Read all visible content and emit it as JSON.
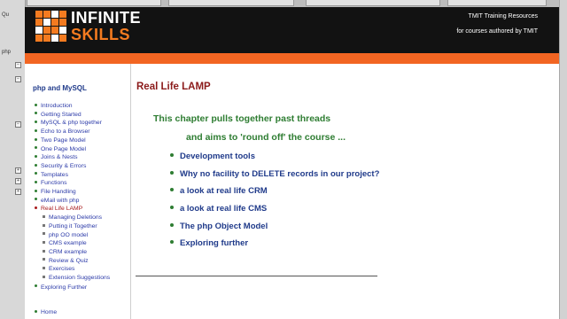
{
  "window": {
    "gutter_labels": [
      "Qu",
      "php"
    ]
  },
  "header": {
    "logo_line1": "INFINITE",
    "logo_line2": "SKILLS",
    "right_line1": "TMIT Training Resources",
    "right_line2": "for courses authored by TMIT"
  },
  "nav": {
    "title": "php and MySQL",
    "items": [
      {
        "label": "Introduction"
      },
      {
        "label": "Getting Started"
      },
      {
        "label": "MySQL & php together"
      },
      {
        "label": "Echo to a Browser"
      },
      {
        "label": "Two Page Model"
      },
      {
        "label": "One Page Model"
      },
      {
        "label": "Joins & Nests"
      },
      {
        "label": "Security & Errors"
      },
      {
        "label": "Templates"
      },
      {
        "label": "Functions"
      },
      {
        "label": "File Handling"
      },
      {
        "label": "eMail with php"
      },
      {
        "label": "Real Life LAMP"
      }
    ],
    "subitems": [
      {
        "label": "Managing Deletions"
      },
      {
        "label": "Putting it Together"
      },
      {
        "label": "php OO model"
      },
      {
        "label": "CMS example"
      },
      {
        "label": "CRM example"
      },
      {
        "label": "Review & Quiz"
      },
      {
        "label": "Exercises"
      },
      {
        "label": "Extension Suggestions"
      }
    ],
    "after_items": [
      {
        "label": "Exploring Further"
      },
      {
        "label": "Home"
      }
    ]
  },
  "main": {
    "title": "Real Life LAMP",
    "intro_line1": "This chapter pulls together past threads",
    "intro_line2": "and aims to 'round off' the course ...",
    "bullets": [
      "Development tools",
      "Why no facility to DELETE records in our project?",
      "a look at real life  CRM",
      "a look at real life CMS",
      "The php Object Model",
      "Exploring further"
    ]
  },
  "colors": {
    "brand_orange": "#f26522",
    "header_bg": "#121212",
    "title_red": "#8b1a1a",
    "intro_green": "#2e7d32",
    "link_blue": "#2b3aa8"
  }
}
